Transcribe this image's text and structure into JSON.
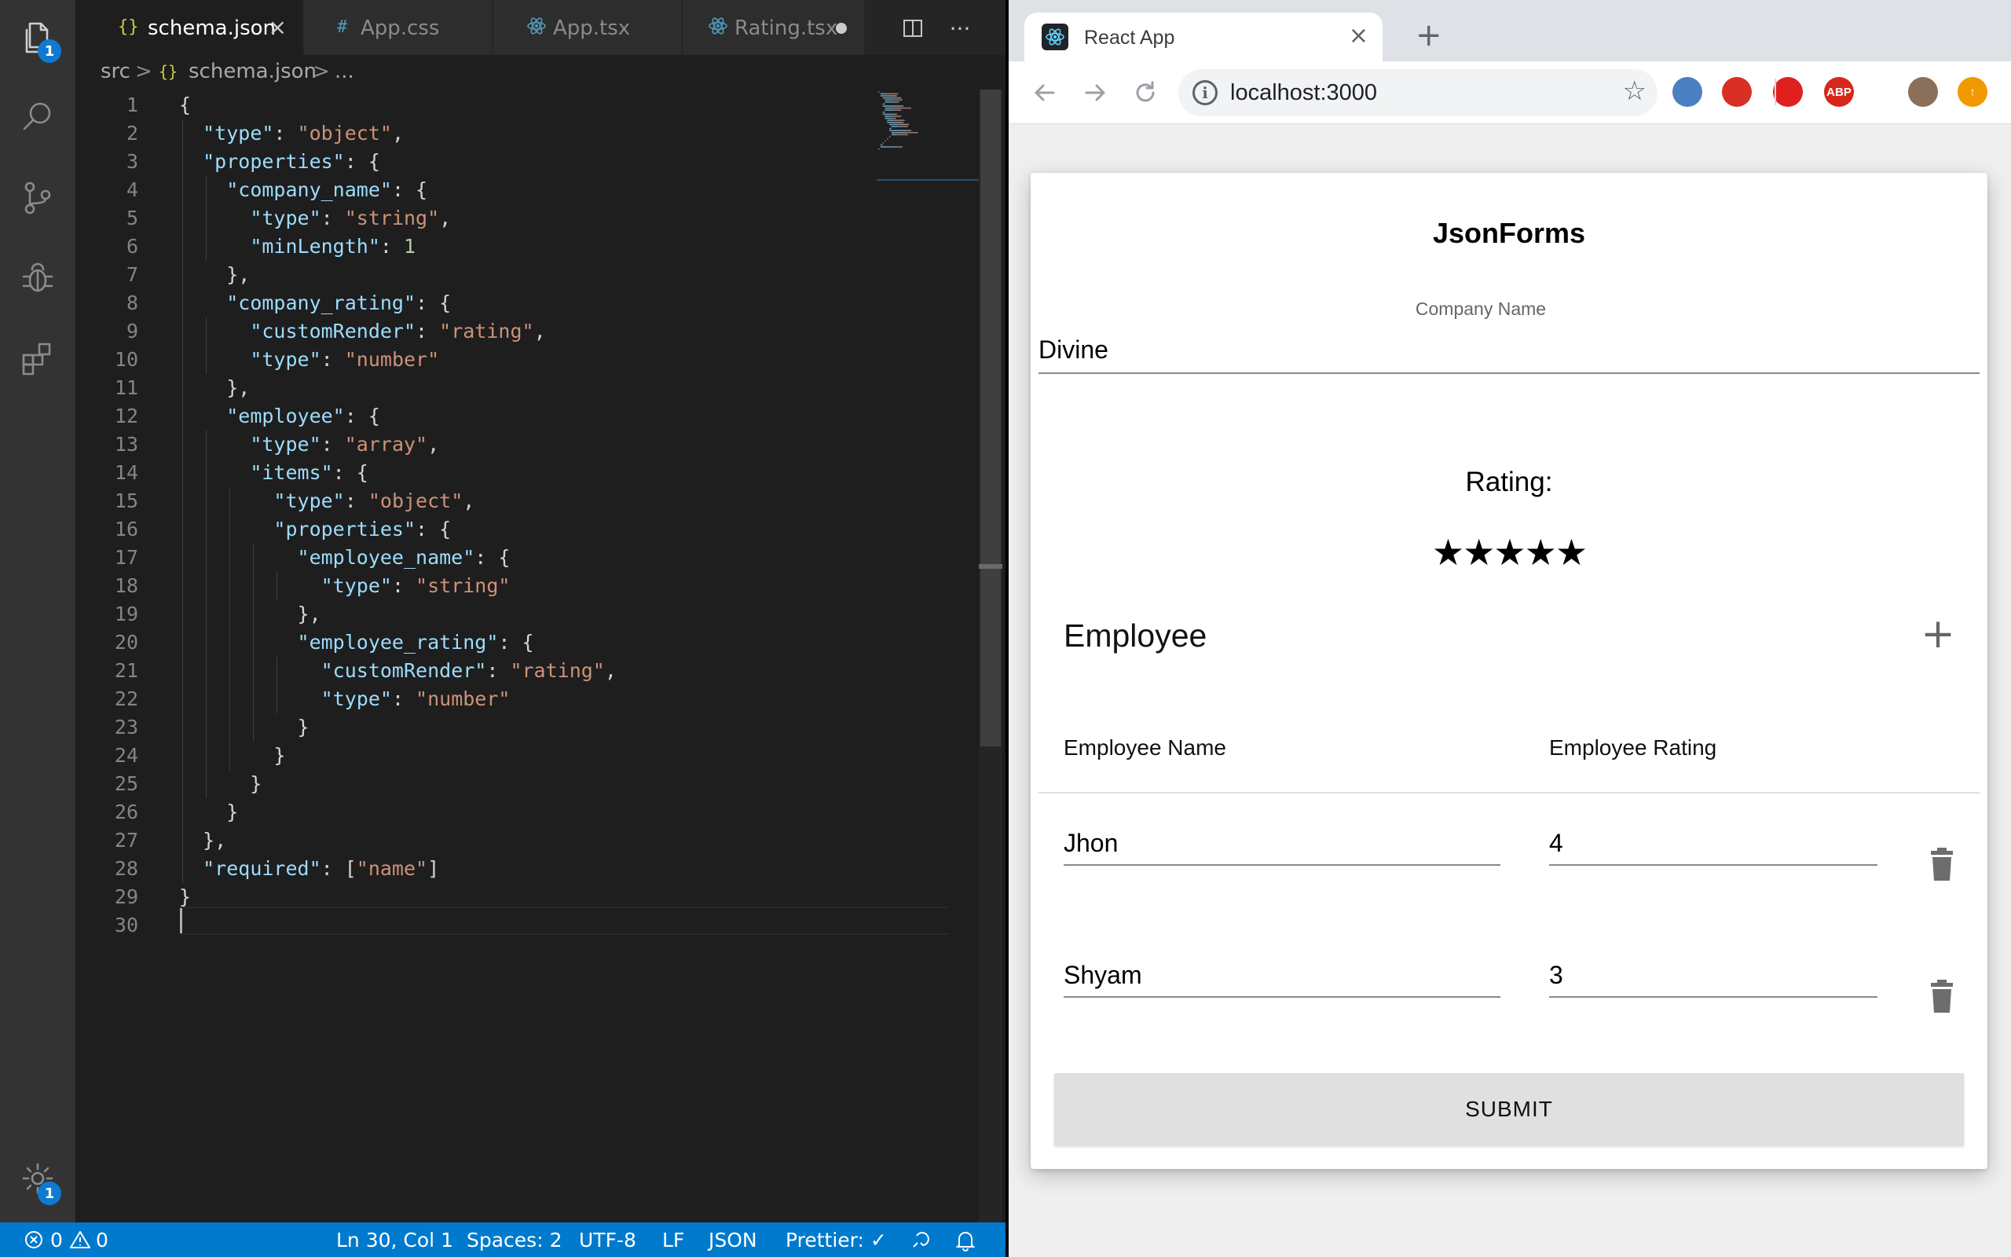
{
  "vscode": {
    "activity_badges": {
      "explorer": "1",
      "settings": "1"
    },
    "tabs": [
      {
        "label": "schema.json",
        "icon": "{}",
        "type": "json",
        "active": true,
        "close": "×"
      },
      {
        "label": "App.css",
        "icon": "#",
        "type": "css",
        "active": false
      },
      {
        "label": "App.tsx",
        "icon": "react-icon",
        "type": "tsx",
        "active": false
      },
      {
        "label": "Rating.tsx",
        "icon": "react-icon",
        "type": "tsx",
        "active": false,
        "modified": true
      }
    ],
    "more_actions": "···",
    "breadcrumb": {
      "folder": "src",
      "sep": ">",
      "file_icon": "{}",
      "file": "schema.json",
      "tail": "..."
    },
    "code_lines": [
      [
        [
          "p",
          "{"
        ]
      ],
      [
        [
          "p",
          "  "
        ],
        [
          "k",
          "\"type\""
        ],
        [
          "p",
          ": "
        ],
        [
          "s",
          "\"object\""
        ],
        [
          "p",
          ","
        ]
      ],
      [
        [
          "p",
          "  "
        ],
        [
          "k",
          "\"properties\""
        ],
        [
          "p",
          ": {"
        ]
      ],
      [
        [
          "p",
          "    "
        ],
        [
          "k",
          "\"company_name\""
        ],
        [
          "p",
          ": {"
        ]
      ],
      [
        [
          "p",
          "      "
        ],
        [
          "k",
          "\"type\""
        ],
        [
          "p",
          ": "
        ],
        [
          "s",
          "\"string\""
        ],
        [
          "p",
          ","
        ]
      ],
      [
        [
          "p",
          "      "
        ],
        [
          "k",
          "\"minLength\""
        ],
        [
          "p",
          ": "
        ],
        [
          "n",
          "1"
        ]
      ],
      [
        [
          "p",
          "    },"
        ]
      ],
      [
        [
          "p",
          "    "
        ],
        [
          "k",
          "\"company_rating\""
        ],
        [
          "p",
          ": {"
        ]
      ],
      [
        [
          "p",
          "      "
        ],
        [
          "k",
          "\"customRender\""
        ],
        [
          "p",
          ": "
        ],
        [
          "s",
          "\"rating\""
        ],
        [
          "p",
          ","
        ]
      ],
      [
        [
          "p",
          "      "
        ],
        [
          "k",
          "\"type\""
        ],
        [
          "p",
          ": "
        ],
        [
          "s",
          "\"number\""
        ]
      ],
      [
        [
          "p",
          "    },"
        ]
      ],
      [
        [
          "p",
          "    "
        ],
        [
          "k",
          "\"employee\""
        ],
        [
          "p",
          ": {"
        ]
      ],
      [
        [
          "p",
          "      "
        ],
        [
          "k",
          "\"type\""
        ],
        [
          "p",
          ": "
        ],
        [
          "s",
          "\"array\""
        ],
        [
          "p",
          ","
        ]
      ],
      [
        [
          "p",
          "      "
        ],
        [
          "k",
          "\"items\""
        ],
        [
          "p",
          ": {"
        ]
      ],
      [
        [
          "p",
          "        "
        ],
        [
          "k",
          "\"type\""
        ],
        [
          "p",
          ": "
        ],
        [
          "s",
          "\"object\""
        ],
        [
          "p",
          ","
        ]
      ],
      [
        [
          "p",
          "        "
        ],
        [
          "k",
          "\"properties\""
        ],
        [
          "p",
          ": {"
        ]
      ],
      [
        [
          "p",
          "          "
        ],
        [
          "k",
          "\"employee_name\""
        ],
        [
          "p",
          ": {"
        ]
      ],
      [
        [
          "p",
          "            "
        ],
        [
          "k",
          "\"type\""
        ],
        [
          "p",
          ": "
        ],
        [
          "s",
          "\"string\""
        ]
      ],
      [
        [
          "p",
          "          },"
        ]
      ],
      [
        [
          "p",
          "          "
        ],
        [
          "k",
          "\"employee_rating\""
        ],
        [
          "p",
          ": {"
        ]
      ],
      [
        [
          "p",
          "            "
        ],
        [
          "k",
          "\"customRender\""
        ],
        [
          "p",
          ": "
        ],
        [
          "s",
          "\"rating\""
        ],
        [
          "p",
          ","
        ]
      ],
      [
        [
          "p",
          "            "
        ],
        [
          "k",
          "\"type\""
        ],
        [
          "p",
          ": "
        ],
        [
          "s",
          "\"number\""
        ]
      ],
      [
        [
          "p",
          "          }"
        ]
      ],
      [
        [
          "p",
          "        }"
        ]
      ],
      [
        [
          "p",
          "      }"
        ]
      ],
      [
        [
          "p",
          "    }"
        ]
      ],
      [
        [
          "p",
          "  },"
        ]
      ],
      [
        [
          "p",
          "  "
        ],
        [
          "k",
          "\"required\""
        ],
        [
          "p",
          ": ["
        ],
        [
          "s",
          "\"name\""
        ],
        [
          "p",
          "]"
        ]
      ],
      [
        [
          "p",
          "}"
        ]
      ],
      [
        [
          "p",
          ""
        ]
      ]
    ],
    "status": {
      "errors": "0",
      "warnings": "0",
      "position": "Ln 30, Col 1",
      "spaces": "Spaces: 2",
      "encoding": "UTF-8",
      "eol": "LF",
      "language": "JSON",
      "prettier": "Prettier: ✓"
    }
  },
  "browser": {
    "tab_title": "React App",
    "tab_close": "×",
    "new_tab": "+",
    "url": "localhost:3000",
    "extensions": [
      {
        "name": "ext-opera-icon",
        "label": "",
        "color": "#4a7fc1"
      },
      {
        "name": "ext-mic-icon",
        "label": "",
        "color": "#d93025"
      },
      {
        "name": "ext-stop-hand-icon",
        "label": "",
        "color": "#e0201e"
      },
      {
        "name": "ext-adblock-icon",
        "label": "ABP",
        "color": "#d7261c"
      },
      {
        "name": "profile-avatar",
        "label": "",
        "color": "#8a6f5b"
      },
      {
        "name": "update-icon",
        "label": "↑",
        "color": "#f29900"
      }
    ],
    "page": {
      "title": "JsonForms",
      "company_name_label": "Company Name",
      "company_name_value": "Divine",
      "rating_label": "Rating:",
      "rating_stars": "★★★★★",
      "rating_value": 5,
      "employee_heading": "Employee",
      "add_button": "+",
      "columns": [
        "Employee Name",
        "Employee Rating"
      ],
      "rows": [
        {
          "name": "Jhon",
          "rating": "4"
        },
        {
          "name": "Shyam",
          "rating": "3"
        }
      ],
      "submit_label": "SUBMIT"
    }
  },
  "colors": {
    "vscode_status": "#007acc",
    "json_key": "#9cdcfe",
    "json_string": "#ce9178",
    "json_number": "#b5cea8"
  }
}
